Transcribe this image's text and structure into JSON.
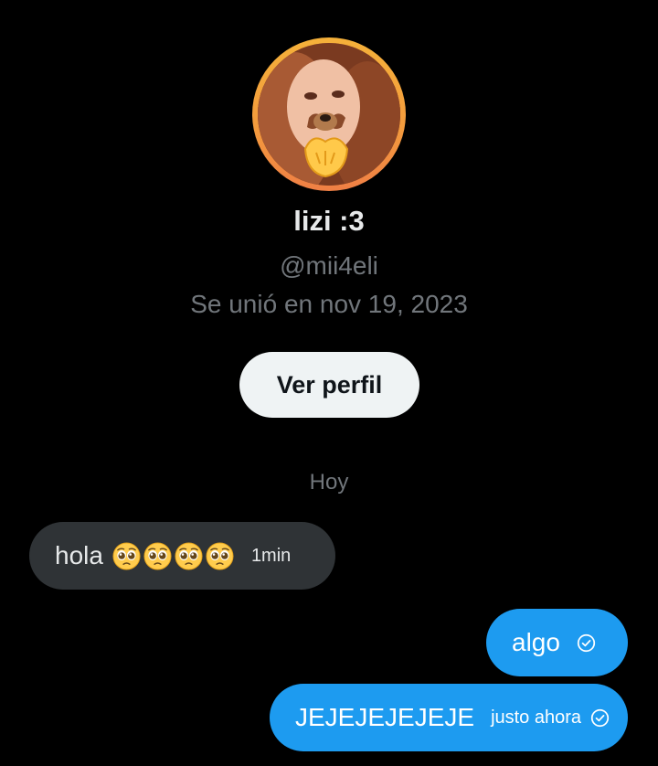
{
  "profile": {
    "display_name": "lizi :3",
    "handle": "@mii4eli",
    "joined": "Se unió en nov 19, 2023",
    "view_profile_label": "Ver perfil"
  },
  "conversation": {
    "day_separator": "Hoy",
    "messages": [
      {
        "direction": "incoming",
        "text": "hola",
        "emojis": [
          "pleading-face",
          "pleading-face",
          "pleading-face",
          "pleading-face"
        ],
        "time": "1min"
      },
      {
        "direction": "outgoing",
        "text": "algo",
        "time": "",
        "status_icon": "sent-check-icon"
      },
      {
        "direction": "outgoing",
        "text": "JEJEJEJEJEJE",
        "time": "justo ahora",
        "status_icon": "sent-check-icon"
      }
    ]
  },
  "colors": {
    "background": "#000000",
    "accent_blue": "#1d9bf0",
    "incoming_bubble": "#2f3336",
    "secondary_text": "#71767b",
    "avatar_ring": "#f5a33b"
  }
}
